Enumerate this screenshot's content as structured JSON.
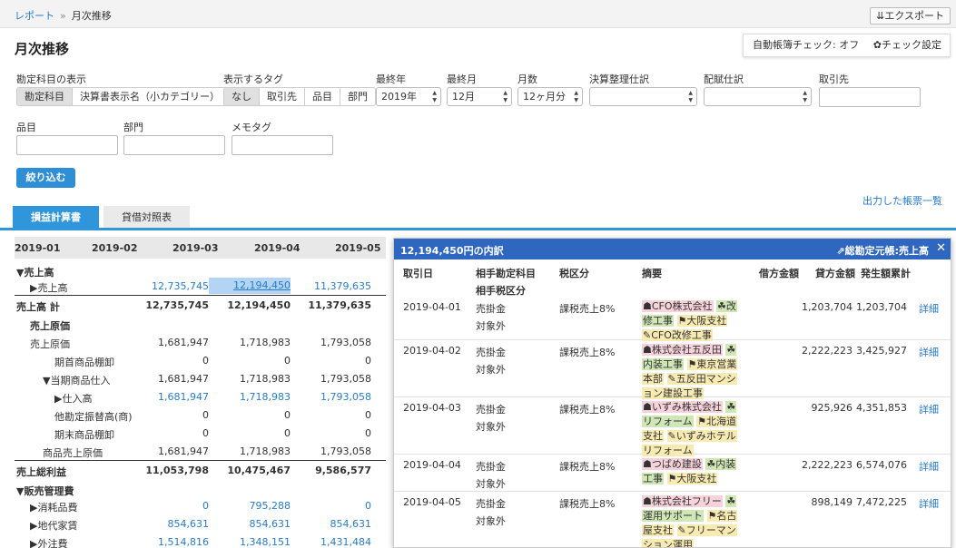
{
  "breadcrumb": {
    "parent": "レポート",
    "separator": "»",
    "current": "月次推移"
  },
  "export_button": "⇊エクスポート",
  "page_title": "月次推移",
  "auto_check": {
    "status": "自動帳簿チェック: オフ",
    "settings": "✿チェック設定"
  },
  "filters": {
    "account_display": {
      "label": "勘定科目の表示",
      "options": [
        "勘定科目",
        "決算書表示名（小カテゴリー）"
      ]
    },
    "tag_display": {
      "label": "表示するタグ",
      "options": [
        "なし",
        "取引先",
        "品目",
        "部門"
      ]
    },
    "last_year": {
      "label": "最終年",
      "value": "2019年"
    },
    "last_month": {
      "label": "最終月",
      "value": "12月"
    },
    "months": {
      "label": "月数",
      "value": "12ヶ月分"
    },
    "closing_entries": {
      "label": "決算整理仕訳",
      "value": ""
    },
    "allocation_entries": {
      "label": "配賦仕訳",
      "value": ""
    },
    "partner": {
      "label": "取引先"
    },
    "item": {
      "label": "品目"
    },
    "department": {
      "label": "部門"
    },
    "memo_tag": {
      "label": "メモタグ"
    }
  },
  "filter_button": "絞り込む",
  "output_link": "出力した帳票一覧",
  "tabs": [
    "損益計算書",
    "貸借対照表"
  ],
  "months_header": [
    "2019-01",
    "2019-02",
    "2019-03",
    "2019-04",
    "2019-05"
  ],
  "rows": [
    {
      "label": "▼売上高",
      "indent": 0,
      "bold": true,
      "values": [
        "",
        "",
        ""
      ]
    },
    {
      "label": "▶売上高",
      "indent": 1,
      "values": [
        "12,735,745",
        "12,194,450",
        "11,379,635"
      ],
      "link": true
    },
    {
      "label": "売上高 計",
      "indent": 0,
      "bold": true,
      "values": [
        "12,735,745",
        "12,194,450",
        "11,379,635"
      ]
    },
    {
      "label": "売上原価",
      "indent": 1,
      "bold": true,
      "values": [
        "",
        "",
        ""
      ]
    },
    {
      "label": "売上原価",
      "indent": 1,
      "values": [
        "1,681,947",
        "1,718,983",
        "1,793,058"
      ]
    },
    {
      "label": "期首商品棚卸",
      "indent": 3,
      "values": [
        "0",
        "0",
        "0"
      ]
    },
    {
      "label": "▼当期商品仕入",
      "indent": 2,
      "values": [
        "1,681,947",
        "1,718,983",
        "1,793,058"
      ]
    },
    {
      "label": "▶仕入高",
      "indent": 3,
      "values": [
        "1,681,947",
        "1,718,983",
        "1,793,058"
      ],
      "link": true
    },
    {
      "label": "他勘定振替高(商)",
      "indent": 3,
      "values": [
        "0",
        "0",
        "0"
      ]
    },
    {
      "label": "期末商品棚卸",
      "indent": 3,
      "values": [
        "0",
        "0",
        "0"
      ]
    },
    {
      "label": "商品売上原価",
      "indent": 2,
      "values": [
        "1,681,947",
        "1,718,983",
        "1,793,058"
      ]
    },
    {
      "label": "売上総利益",
      "indent": 0,
      "bold": true,
      "values": [
        "11,053,798",
        "10,475,467",
        "9,586,577"
      ]
    },
    {
      "label": "▼販売管理費",
      "indent": 0,
      "bold": true,
      "values": [
        "",
        "",
        ""
      ]
    },
    {
      "label": "▶消耗品費",
      "indent": 1,
      "values": [
        "0",
        "795,288",
        "0"
      ],
      "link": true
    },
    {
      "label": "▶地代家賃",
      "indent": 1,
      "values": [
        "854,631",
        "854,631",
        "854,631"
      ],
      "link": true
    },
    {
      "label": "▶外注費",
      "indent": 1,
      "values": [
        "1,514,816",
        "1,348,151",
        "1,431,484"
      ],
      "link": true
    }
  ],
  "popup": {
    "title": "12,194,450円の内訳",
    "ledger_link": "⇗総勘定元帳:売上高",
    "close": "✕",
    "columns": [
      "取引日",
      "相手勘定科目",
      "税区分",
      "摘要",
      "借方金額",
      "貸方金額",
      "発生額累計"
    ],
    "subcolumn": "相手税区分",
    "rows": [
      {
        "date": "2019-04-01",
        "account": "売掛金",
        "tax_partner": "対象外",
        "tax": "課税売上8%",
        "tags": [
          {
            "t": "☗CFO株式会社",
            "c": "tp"
          },
          {
            "t": "☘改修工事",
            "c": "tgr"
          },
          {
            "t": "⚑大阪支社",
            "c": "ty"
          },
          {
            "t": "✎CFO改修工事",
            "c": "ty"
          }
        ],
        "debit": "",
        "credit": "1,203,704",
        "cumulative": "1,203,704",
        "detail": "詳細"
      },
      {
        "date": "2019-04-02",
        "account": "売掛金",
        "tax_partner": "対象外",
        "tax": "課税売上8%",
        "tags": [
          {
            "t": "☗株式会社五反田",
            "c": "tp"
          },
          {
            "t": "☘内装工事",
            "c": "tgr"
          },
          {
            "t": "⚑東京営業本部",
            "c": "ty"
          },
          {
            "t": "✎五反田マンション建設工事",
            "c": "ty"
          }
        ],
        "debit": "",
        "credit": "2,222,223",
        "cumulative": "3,425,927",
        "detail": "詳細"
      },
      {
        "date": "2019-04-03",
        "account": "売掛金",
        "tax_partner": "対象外",
        "tax": "課税売上8%",
        "tags": [
          {
            "t": "☗いずみ株式会社",
            "c": "tp"
          },
          {
            "t": "☘リフォーム",
            "c": "tgr"
          },
          {
            "t": "⚑北海道支社",
            "c": "ty"
          },
          {
            "t": "✎いずみホテルリフォーム",
            "c": "ty"
          }
        ],
        "debit": "",
        "credit": "925,926",
        "cumulative": "4,351,853",
        "detail": "詳細"
      },
      {
        "date": "2019-04-04",
        "account": "売掛金",
        "tax_partner": "対象外",
        "tax": "課税売上8%",
        "tags": [
          {
            "t": "☗つばめ建設",
            "c": "tp"
          },
          {
            "t": "☘内装工事",
            "c": "tgr"
          },
          {
            "t": "⚑大阪支社",
            "c": "ty"
          }
        ],
        "debit": "",
        "credit": "2,222,223",
        "cumulative": "6,574,076",
        "detail": "詳細"
      },
      {
        "date": "2019-04-05",
        "account": "売掛金",
        "tax_partner": "対象外",
        "tax": "課税売上8%",
        "tags": [
          {
            "t": "☗株式会社フリー",
            "c": "tp"
          },
          {
            "t": "☘運用サポート",
            "c": "tgr"
          },
          {
            "t": "⚑名古屋支社",
            "c": "ty"
          },
          {
            "t": "✎フリーマンション運用",
            "c": "ty"
          }
        ],
        "debit": "",
        "credit": "898,149",
        "cumulative": "7,472,225",
        "detail": "詳細"
      }
    ]
  }
}
